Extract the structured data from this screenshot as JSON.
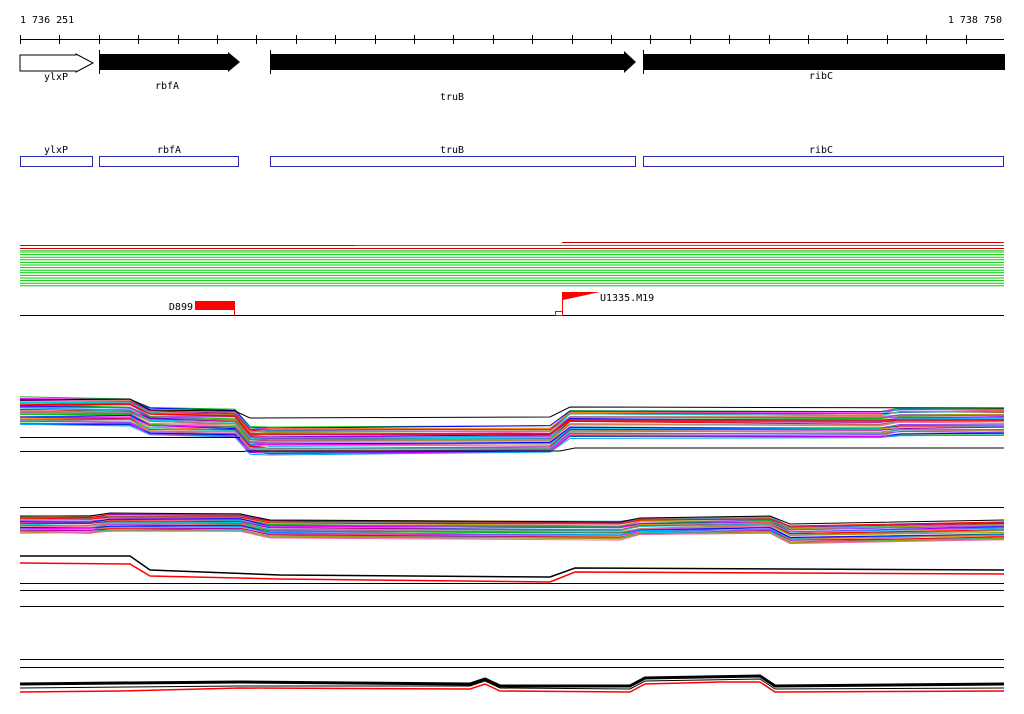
{
  "coordinates": {
    "start": "1 736 251",
    "end": "1 738 750"
  },
  "genes": [
    {
      "name": "ylxP",
      "strand": "+",
      "filled": false
    },
    {
      "name": "rbfA",
      "strand": "+",
      "filled": true
    },
    {
      "name": "truB",
      "strand": "+",
      "filled": true
    },
    {
      "name": "ribC",
      "strand": "+",
      "filled": true
    }
  ],
  "gene_boxes": [
    "ylxP",
    "rbfA",
    "truB",
    "ribC"
  ],
  "features": [
    {
      "label": "D899",
      "kind": "block"
    },
    {
      "label": "U1335.M19",
      "kind": "flag"
    }
  ],
  "colors": {
    "gene_outline": "#2b2bb0",
    "feature": "#ff0000",
    "read_green": "#00cc00",
    "read_red": "#cc0000"
  },
  "profile_palette": [
    "#00c000",
    "#0000ff",
    "#ff00ff",
    "#00aaff",
    "#ff8800",
    "#aa00aa",
    "#ff0000",
    "#00d2c8",
    "#888888",
    "#a0a000",
    "#ff66aa",
    "#8844ff"
  ]
}
